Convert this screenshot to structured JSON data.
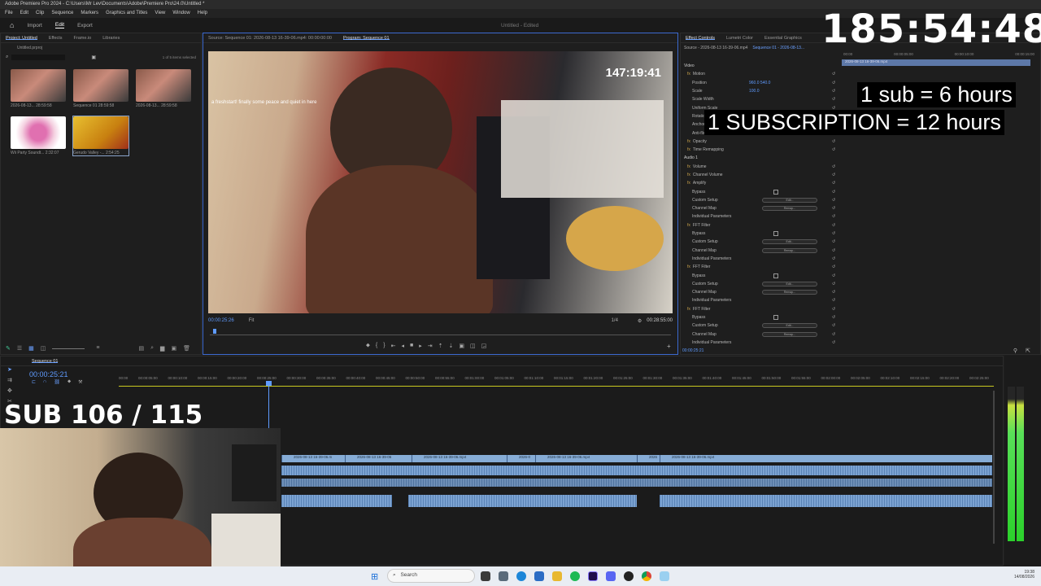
{
  "app": {
    "title": "Adobe Premiere Pro 2024 - C:\\Users\\Mr Lev\\Documents\\Adobe\\Premiere Pro\\24.0\\Untitled *",
    "menu": [
      "File",
      "Edit",
      "Clip",
      "Sequence",
      "Markers",
      "Graphics and Titles",
      "View",
      "Window",
      "Help"
    ],
    "workspace_tabs": [
      "Import",
      "Edit",
      "Export"
    ],
    "doc_title": "Untitled - Edited"
  },
  "overlay": {
    "big_clock": "185:54:48",
    "sub_rule": "1 sub = 6 hours",
    "subscription_rule": "1 SUBSCRIPTION = 12 hours",
    "sub_counter": "SUB 106 / 115",
    "video_clock": "147:19:41",
    "video_caption": "a freshstart! finally some peace and quiet in here"
  },
  "project": {
    "tabs": [
      "Project: Untitled",
      "Effects",
      "Frame.io",
      "Libraries"
    ],
    "file": "Untitled.prproj",
    "count": "1 of 5 items selected",
    "items": [
      {
        "name": "2026-08-13...",
        "dur": "28:59:58"
      },
      {
        "name": "Sequence 01",
        "dur": "28:59:58"
      },
      {
        "name": "2026-08-13...",
        "dur": "28:59:58"
      },
      {
        "name": "Wii Party Soundt...",
        "dur": "2:32:07"
      },
      {
        "name": "Gerudo Valley -...",
        "dur": "2:54:25"
      }
    ]
  },
  "monitor": {
    "source_tab": "Source: Sequence 01: 2026-08-13 16-39-06.mp4: 00:00:00:00",
    "program_tab": "Program: Sequence 01",
    "timecode": "00:00:25:26",
    "fit": "Fit",
    "quality": "1/4",
    "duration": "00:28:55:00"
  },
  "effects": {
    "tabs": [
      "Effect Controls",
      "Lumetri Color",
      "Essential Graphics"
    ],
    "source": "Source - 2026-08-13 16-39-06.mp4",
    "sequence": "Sequence 01 - 2026-08-13...",
    "rows": [
      {
        "label": "Video",
        "kind": "header"
      },
      {
        "label": "Motion",
        "kind": "fx"
      },
      {
        "label": "Position",
        "kind": "value",
        "v": "960.0   540.0"
      },
      {
        "label": "Scale",
        "kind": "value",
        "v": "100.0"
      },
      {
        "label": "Scale Width",
        "kind": "value",
        "v": ""
      },
      {
        "label": "Uniform Scale",
        "kind": "value",
        "v": ""
      },
      {
        "label": "Rotation",
        "kind": "value",
        "v": ""
      },
      {
        "label": "Anchor Point",
        "kind": "value",
        "v": ""
      },
      {
        "label": "Anti-flicker Filter",
        "kind": "value",
        "v": ""
      },
      {
        "label": "Opacity",
        "kind": "fx"
      },
      {
        "label": "Time Remapping",
        "kind": "fx"
      },
      {
        "label": "Audio 1",
        "kind": "header"
      },
      {
        "label": "Volume",
        "kind": "fx"
      },
      {
        "label": "Channel Volume",
        "kind": "fx"
      },
      {
        "label": "Amplify",
        "kind": "fx"
      },
      {
        "label": "Bypass",
        "kind": "check"
      },
      {
        "label": "Custom Setup",
        "kind": "button",
        "v": "Edit..."
      },
      {
        "label": "Channel Map",
        "kind": "button",
        "v": "Remap..."
      },
      {
        "label": "Individual Parameters",
        "kind": "value",
        "v": ""
      },
      {
        "label": "FFT Filter",
        "kind": "fx"
      },
      {
        "label": "Bypass",
        "kind": "check"
      },
      {
        "label": "Custom Setup",
        "kind": "button",
        "v": "Edit..."
      },
      {
        "label": "Channel Map",
        "kind": "button",
        "v": "Remap..."
      },
      {
        "label": "Individual Parameters",
        "kind": "value",
        "v": ""
      },
      {
        "label": "FFT Filter",
        "kind": "fx"
      },
      {
        "label": "Bypass",
        "kind": "check"
      },
      {
        "label": "Custom Setup",
        "kind": "button",
        "v": "Edit..."
      },
      {
        "label": "Channel Map",
        "kind": "button",
        "v": "Remap..."
      },
      {
        "label": "Individual Parameters",
        "kind": "value",
        "v": ""
      },
      {
        "label": "FFT Filter",
        "kind": "fx"
      },
      {
        "label": "Bypass",
        "kind": "check"
      },
      {
        "label": "Custom Setup",
        "kind": "button",
        "v": "Edit..."
      },
      {
        "label": "Channel Map",
        "kind": "button",
        "v": "Remap..."
      },
      {
        "label": "Individual Parameters",
        "kind": "value",
        "v": ""
      }
    ],
    "ruler": [
      "00:00",
      "00:00:05:00",
      "00:00:10:00",
      "00:00:15:00"
    ],
    "clip": "2026-08-13 16-39-06.mp4",
    "footer_tc": "00:00:25:21"
  },
  "timeline": {
    "tab": "Sequence 01",
    "timecode": "00:00:25:21",
    "ruler": [
      "00:00",
      "00:00:05:00",
      "00:00:10:00",
      "00:00:15:00",
      "00:00:20:00",
      "00:00:25:00",
      "00:00:30:00",
      "00:00:35:00",
      "00:00:40:00",
      "00:00:45:00",
      "00:00:50:00",
      "00:00:55:00",
      "00:01:00:00",
      "00:01:05:00",
      "00:01:10:00",
      "00:01:15:00",
      "00:01:20:00",
      "00:01:25:00",
      "00:01:30:00",
      "00:01:35:00",
      "00:01:40:00",
      "00:01:45:00",
      "00:01:50:00",
      "00:01:55:00",
      "00:02:00:00",
      "00:02:05:00",
      "00:02:10:00",
      "00:02:15:00",
      "00:02:20:00",
      "00:02:25:00"
    ],
    "clips": [
      {
        "label": "2026-08-13 16-39-06.m"
      },
      {
        "label": "2026-08-13 16-39-06"
      },
      {
        "label": "2026-08-13 16-39-06.mp4"
      },
      {
        "label": "2026-0"
      },
      {
        "label": "2026-08-13 16-39-06.mp4"
      },
      {
        "label": "2026"
      },
      {
        "label": "2026-08-13 16-39-06.mp4"
      }
    ]
  },
  "taskbar": {
    "search": "Search",
    "time": "19:38",
    "date": "14/08/2026"
  }
}
